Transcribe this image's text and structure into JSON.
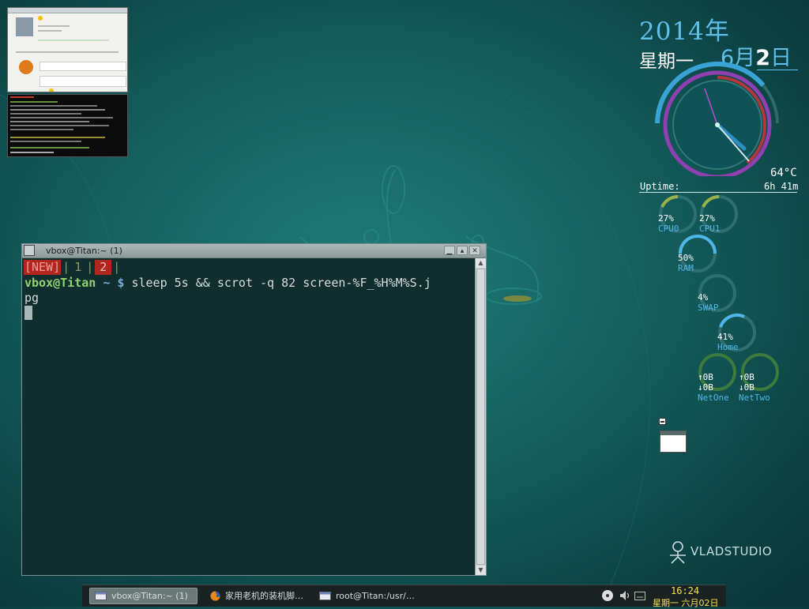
{
  "terminal": {
    "title": "vbox@Titan:~ (1)",
    "tabs": {
      "new": "[NEW]",
      "sep": "|",
      "tab1": "1",
      "tab2": "2"
    },
    "prompt_user": "vbox@Titan",
    "prompt_path": "~ $",
    "command_line1": " sleep 5s && scrot -q 82 screen-%F_%H%M%S.j",
    "command_line2": "pg"
  },
  "conky": {
    "year": "2014年",
    "weekday": "星期一",
    "month": "6月",
    "day": "2",
    "day_suffix": "日",
    "temperature": "64°C",
    "uptime_label": "Uptime:",
    "uptime_value": "6h 41m",
    "gauges": {
      "cpu0": {
        "value": "27%",
        "label": "CPU0",
        "level": 0.27
      },
      "cpu1": {
        "value": "27%",
        "label": "CPU1",
        "level": 0.27
      },
      "ram": {
        "value": "50%",
        "label": "RAM",
        "level": 0.5
      },
      "swap": {
        "value": "4%",
        "label": "SWAP",
        "level": 0.04
      },
      "home": {
        "value": "41%",
        "label": "Home",
        "level": 0.41
      },
      "netone": {
        "up": "↑0B",
        "down": "↓0B",
        "label": "NetOne"
      },
      "nettwo": {
        "up": "↑0B",
        "down": "↓0B",
        "label": "NetTwo"
      }
    }
  },
  "watermark": {
    "text": "VLADSTUDIO"
  },
  "taskbar": {
    "tasks": [
      {
        "label": "vbox@Titan:~ (1)",
        "icon": "terminal-icon",
        "active": true
      },
      {
        "label": "家用老机的装机脚…",
        "icon": "firefox-icon",
        "active": false
      },
      {
        "label": "root@Titan:/usr/…",
        "icon": "terminal-icon",
        "active": false
      }
    ],
    "clock_time": "16:24",
    "clock_date": "星期一 六月02日"
  },
  "colors": {
    "accent_blue": "#4fb6e8",
    "prompt_green": "#8fd46e",
    "tab_red": "#b3261e",
    "clock_yellow": "#f4e34c"
  }
}
